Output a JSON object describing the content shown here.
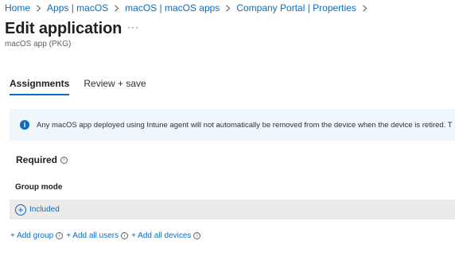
{
  "breadcrumb": [
    "Home",
    "Apps | macOS",
    "macOS | macOS apps",
    "Company Portal | Properties"
  ],
  "page": {
    "title": "Edit application",
    "more": "···",
    "subtitle": "macOS app (PKG)"
  },
  "tabs": [
    {
      "label": "Assignments",
      "active": true
    },
    {
      "label": "Review + save",
      "active": false
    }
  ],
  "info_bar": {
    "icon": "info-icon",
    "text": "Any macOS app deployed using Intune agent will not automatically be removed from the device when the device is retired. T"
  },
  "required": {
    "title": "Required",
    "column_header": "Group mode",
    "included_label": "Included",
    "links": {
      "add_group": "+ Add group",
      "add_all_users": "+ Add all users",
      "add_all_devices": "+ Add all devices"
    }
  },
  "colors": {
    "accent": "#0f6cbd",
    "info_background": "#eff6fc",
    "row_background": "#edebe9"
  }
}
